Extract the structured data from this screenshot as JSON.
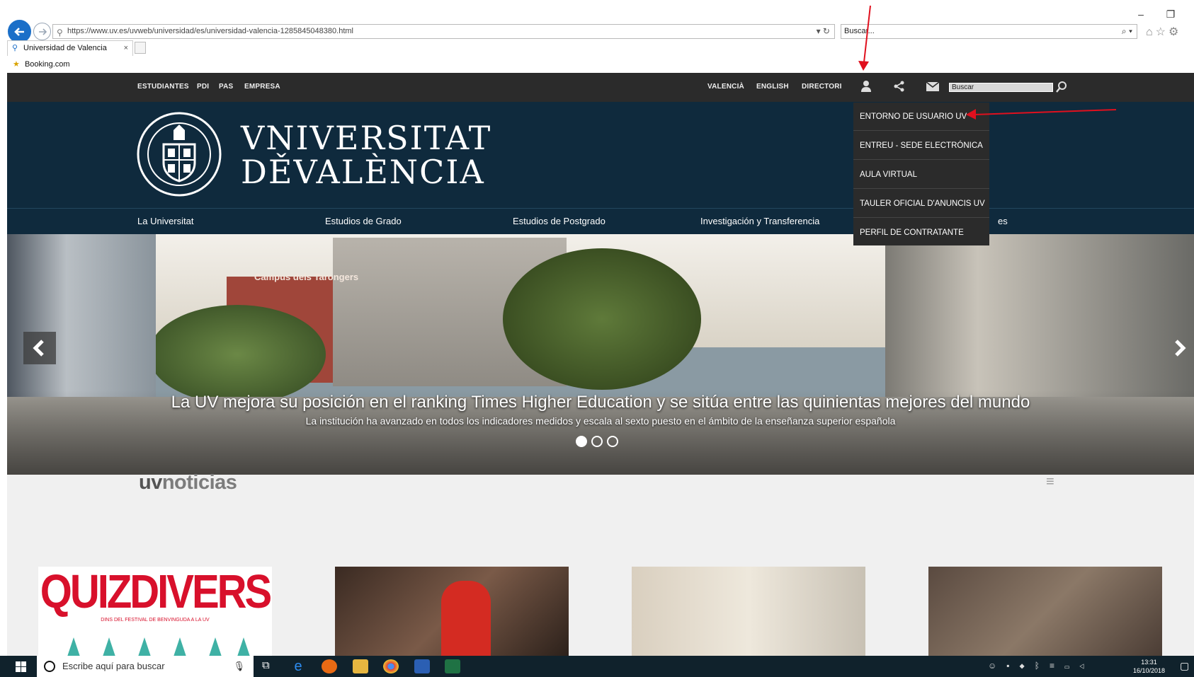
{
  "browser": {
    "url": "https://www.uv.es/uvweb/universidad/es/universidad-valencia-1285845048380.html",
    "search_placeholder": "Buscar...",
    "tab_title": "Universidad de Valencia",
    "favorites": [
      "Booking.com"
    ]
  },
  "topbar": {
    "left_links": [
      "ESTUDIANTES",
      "PDI",
      "PAS",
      "EMPRESA"
    ],
    "right_links": [
      "VALENCIÀ",
      "ENGLISH",
      "DIRECTORI"
    ],
    "search_value": "Buscar"
  },
  "header": {
    "brand_line1": "VNIVERSITAT",
    "brand_line2": "DĚVALÈNCIA"
  },
  "main_nav": [
    "La Universitat",
    "Estudios de Grado",
    "Estudios de Postgrado",
    "Investigación y Transferencia",
    "es"
  ],
  "user_menu": {
    "items": [
      "ENTORNO DE USUARIO UV",
      "ENTREU - SEDE ELECTRÓNICA",
      "AULA VIRTUAL",
      "TAULER OFICIAL D'ANUNCIS UV",
      "PERFIL DE CONTRATANTE"
    ]
  },
  "hero": {
    "sign": "Campus dels Tarongers",
    "title": "La UV mejora su posición en el ranking Times Higher Education y se sitúa entre las quinientas mejores del mundo",
    "subtitle": "La institución ha avanzado en todos los indicadores medidos y escala al sexto puesto en el ámbito de la enseñanza superior española",
    "slide_count": 3,
    "active_slide": 1
  },
  "news": {
    "logo_a": "uv",
    "logo_b": "noticias",
    "card1_title": "QUIZDIVERS",
    "card1_sub": "DINS DEL FESTIVAL DE BENVINGUDA A LA UV"
  },
  "taskbar": {
    "search_placeholder": "Escribe aquí para buscar",
    "time": "13:31",
    "date": "16/10/2018"
  },
  "colors": {
    "header_bg": "#0f2a3d",
    "topbar_bg": "#2b2b2b",
    "annotation": "#e0101e"
  }
}
